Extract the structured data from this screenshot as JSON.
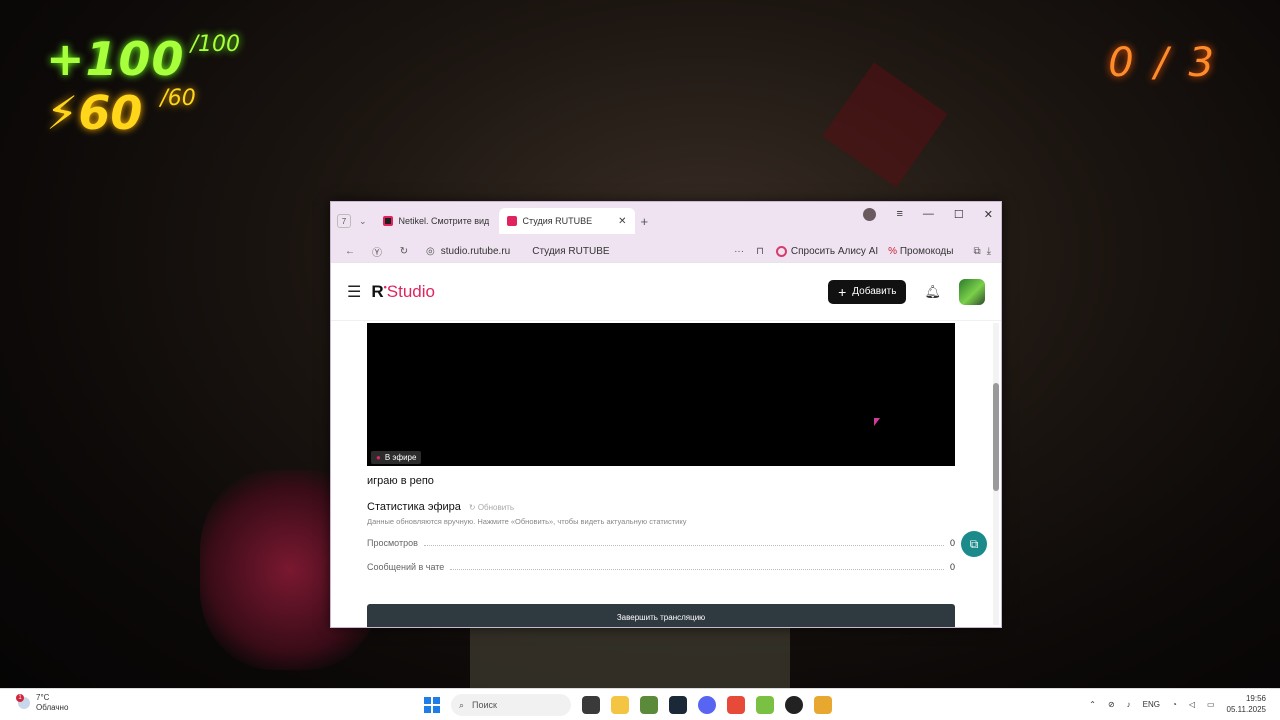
{
  "hud": {
    "health": "+100",
    "health_max": "/100",
    "energy": "60",
    "energy_max": "/60",
    "counter": "0 / 3"
  },
  "browser": {
    "tab_count": "7",
    "tabs": [
      {
        "label": "Netikel. Смотрите видео"
      },
      {
        "label": "Студия RUTUBE"
      }
    ],
    "url": "studio.rutube.ru",
    "page_title": "Студия RUTUBE",
    "alice_label": "Спросить Алису AI",
    "promo_label": "Промокоды"
  },
  "studio": {
    "logo_r": "R",
    "logo_text": "Studio",
    "add_label": "Добавить",
    "live_label": "В эфире",
    "stream_title": "играю в репо",
    "stats_title": "Статистика эфира",
    "refresh_label": "Обновить",
    "stats_note": "Данные обновляются вручную. Нажмите «Обновить», чтобы видеть актуальную статистику",
    "stats": [
      {
        "label": "Просмотров",
        "value": "0"
      },
      {
        "label": "Сообщений в чате",
        "value": "0"
      }
    ],
    "end_label": "Завершить трансляцию"
  },
  "taskbar": {
    "temp": "7°C",
    "weather": "Облачно",
    "notif_count": "1",
    "search_placeholder": "Поиск",
    "lang": "ENG",
    "time": "19:56",
    "date": "05.11.2025"
  },
  "colors": {
    "accent": "#e0245e",
    "health": "#a8ff3c",
    "energy": "#ffd61a",
    "counter": "#ff8c2a"
  }
}
